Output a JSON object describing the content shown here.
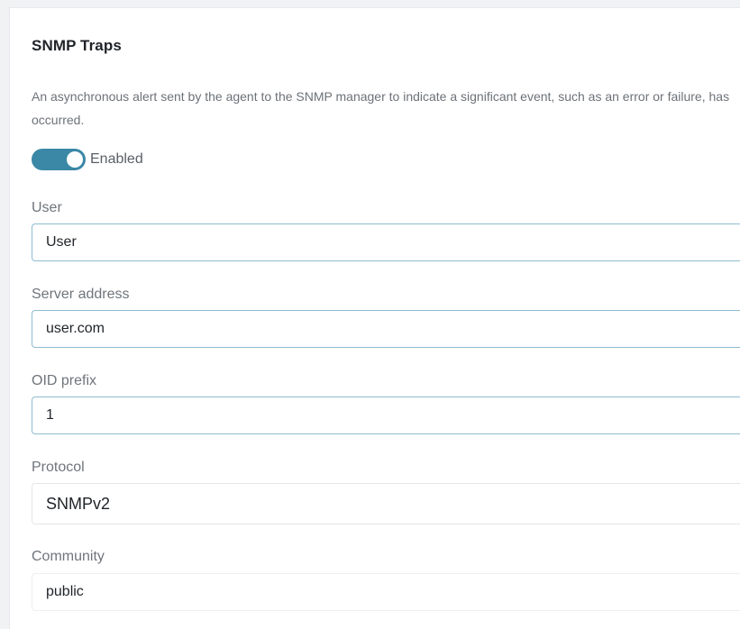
{
  "section": {
    "title": "SNMP Traps",
    "description": "An asynchronous alert sent by the agent to the SNMP manager to indicate a significant event, such as an error or failure, has occurred."
  },
  "toggle": {
    "label": "Enabled",
    "state": "on",
    "color": "#3a87a6"
  },
  "fields": {
    "user": {
      "label": "User",
      "value": "User"
    },
    "server_address": {
      "label": "Server address",
      "value": "user.com"
    },
    "oid_prefix": {
      "label": "OID prefix",
      "value": "1"
    },
    "protocol": {
      "label": "Protocol",
      "value": "SNMPv2"
    },
    "community": {
      "label": "Community",
      "value": "public"
    }
  }
}
